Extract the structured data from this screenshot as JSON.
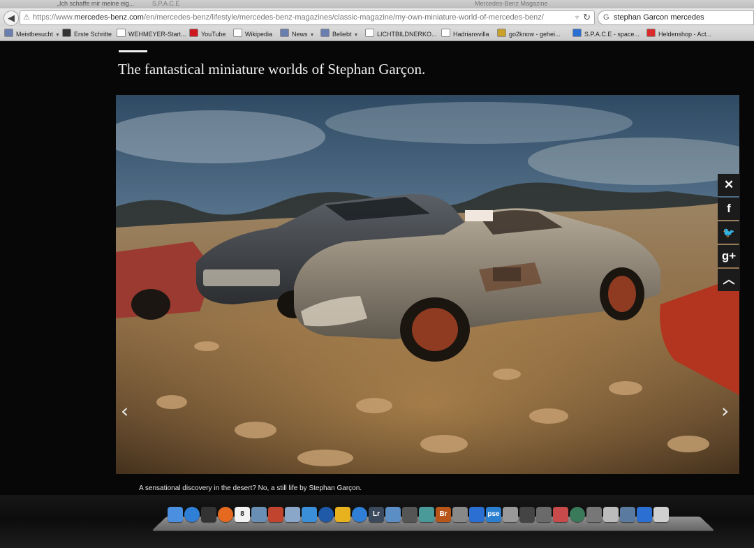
{
  "browser": {
    "tabs": [
      {
        "label": "„Ich schaffe mir meine eig..."
      },
      {
        "label": "S.P.A.C.E"
      },
      {
        "label": "Mercedes-Benz Magazine"
      }
    ],
    "url": {
      "prefix": "https://www.",
      "domain": "mercedes-benz.com",
      "path": "/en/mercedes-benz/lifestyle/mercedes-benz-magazines/classic-magazine/my-own-miniature-world-of-mercedes-benz/"
    },
    "search_value": "stephan Garcon mercedes",
    "bookmarks": [
      {
        "label": "Meistbesucht",
        "dropdown": true,
        "icon": "folder-icon",
        "color": "#6a7fb0"
      },
      {
        "label": "Erste Schritte",
        "dropdown": false,
        "icon": "mozilla-icon",
        "color": "#333333"
      },
      {
        "label": "WEHMEYER-Start...",
        "dropdown": false,
        "icon": "page-icon",
        "color": "#ffffff"
      },
      {
        "label": "YouTube",
        "dropdown": false,
        "icon": "youtube-icon",
        "color": "#cc181e"
      },
      {
        "label": "Wikipedia",
        "dropdown": false,
        "icon": "wikipedia-icon",
        "color": "#ffffff"
      },
      {
        "label": "News",
        "dropdown": true,
        "icon": "folder-icon",
        "color": "#6a7fb0"
      },
      {
        "label": "Beliebt",
        "dropdown": true,
        "icon": "folder-icon",
        "color": "#6a7fb0"
      },
      {
        "label": "LICHTBILDNERKO...",
        "dropdown": false,
        "icon": "page-icon",
        "color": "#ffffff"
      },
      {
        "label": "Hadriansvilla",
        "dropdown": false,
        "icon": "page-icon",
        "color": "#ffffff"
      },
      {
        "label": "go2know - gehei...",
        "dropdown": false,
        "icon": "go2know-icon",
        "color": "#c9a227"
      },
      {
        "label": "S.P.A.C.E - space...",
        "dropdown": false,
        "icon": "space-icon",
        "color": "#2a6fd1"
      },
      {
        "label": "Heldenshop - Act...",
        "dropdown": false,
        "icon": "star-icon",
        "color": "#d92b2b"
      }
    ]
  },
  "article": {
    "title": "The fantastical miniature worlds of Stephan Garçon.",
    "image_description_alt": "",
    "caption": "A sensational discovery in the desert? No, a still life by Stephan Garçon.",
    "prev_arrow": "‹",
    "next_arrow": "›"
  },
  "share": [
    {
      "name": "close",
      "glyph": "✕"
    },
    {
      "name": "facebook",
      "glyph": "f"
    },
    {
      "name": "twitter",
      "glyph": "🐦"
    },
    {
      "name": "googleplus",
      "glyph": "g+"
    },
    {
      "name": "scroll-up",
      "glyph": "︿"
    }
  ],
  "dock": [
    {
      "name": "finder-icon",
      "color": "#4a8fe0",
      "label": ""
    },
    {
      "name": "safari-icon",
      "color": "#2f7fd6",
      "label": ""
    },
    {
      "name": "dashboard-icon",
      "color": "#333333",
      "label": ""
    },
    {
      "name": "firefox-icon",
      "color": "#e56a1f",
      "label": ""
    },
    {
      "name": "calendar-icon",
      "color": "#f2f2f2",
      "label": "8"
    },
    {
      "name": "preview-icon",
      "color": "#6a8fb5",
      "label": ""
    },
    {
      "name": "photos-icon",
      "color": "#c0442e",
      "label": ""
    },
    {
      "name": "mail-icon",
      "color": "#8aa7c9",
      "label": ""
    },
    {
      "name": "sync-icon",
      "color": "#3b8ed8",
      "label": ""
    },
    {
      "name": "google-earth-icon",
      "color": "#1e5aa8",
      "label": ""
    },
    {
      "name": "aldi-icon",
      "color": "#e8b21e",
      "label": ""
    },
    {
      "name": "itunes-icon",
      "color": "#2f7fd6",
      "label": ""
    },
    {
      "name": "lightroom-icon",
      "color": "#3a4a5c",
      "label": "Lr"
    },
    {
      "name": "app-store-icon",
      "color": "#5a8ec4",
      "label": ""
    },
    {
      "name": "printer-icon",
      "color": "#555555",
      "label": ""
    },
    {
      "name": "refresh-app-icon",
      "color": "#4a9a9a",
      "label": ""
    },
    {
      "name": "bridge-icon",
      "color": "#b8561a",
      "label": "Br"
    },
    {
      "name": "camera-icon",
      "color": "#888888",
      "label": ""
    },
    {
      "name": "bookmark-app-icon",
      "color": "#2a6fd1",
      "label": ""
    },
    {
      "name": "pse-icon",
      "color": "#2a7fd1",
      "label": "pse"
    },
    {
      "name": "scanner-icon",
      "color": "#999999",
      "label": ""
    },
    {
      "name": "speaker-icon",
      "color": "#444444",
      "label": ""
    },
    {
      "name": "utility-icon",
      "color": "#6a6a6a",
      "label": ""
    },
    {
      "name": "game-icon",
      "color": "#c94a4a",
      "label": ""
    },
    {
      "name": "time-machine-icon",
      "color": "#3a7a5a",
      "label": ""
    },
    {
      "name": "tools-icon",
      "color": "#777777",
      "label": ""
    },
    {
      "name": "screenshot-icon",
      "color": "#bbbbbb",
      "label": ""
    },
    {
      "name": "photo-viewer-icon",
      "color": "#5a7aa0",
      "label": ""
    },
    {
      "name": "document-icon",
      "color": "#2a6fd1",
      "label": ""
    },
    {
      "name": "trash-icon",
      "color": "#cfcfcf",
      "label": ""
    }
  ]
}
